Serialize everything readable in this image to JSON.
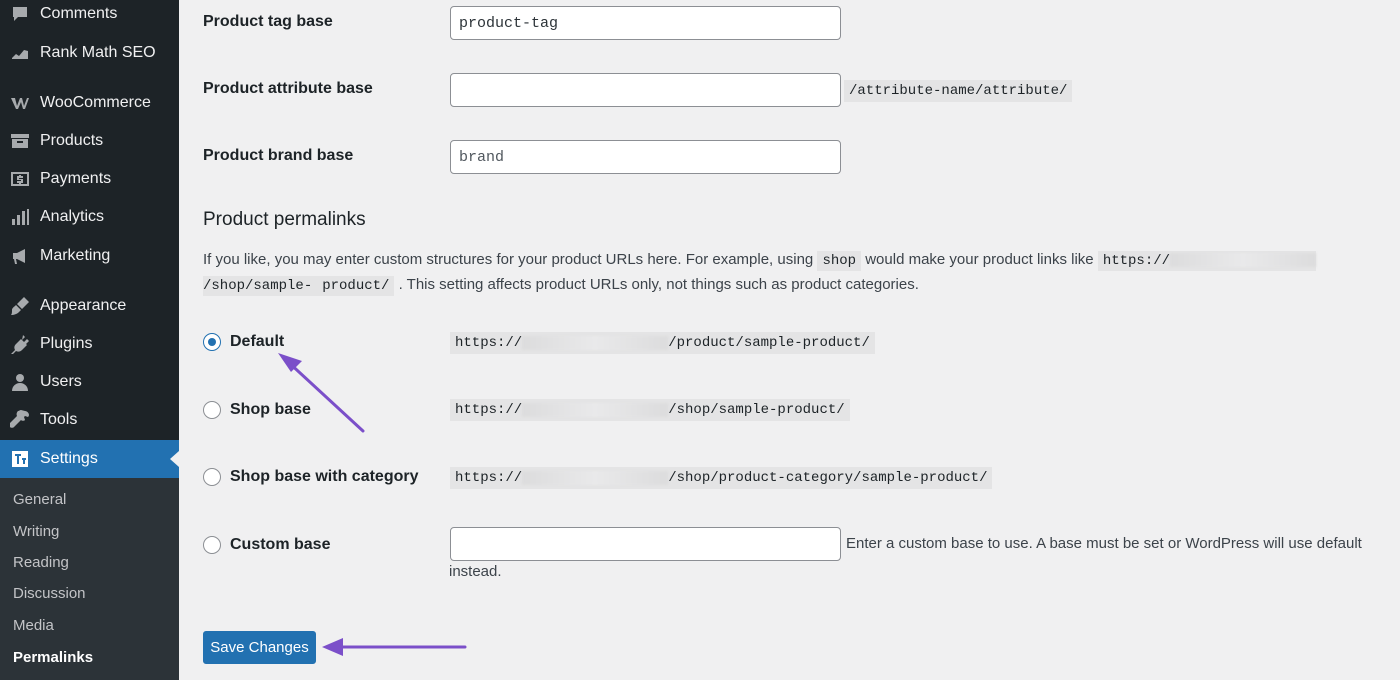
{
  "sidebar": {
    "items": [
      {
        "label": "Comments",
        "icon": "comment-icon"
      },
      {
        "label": "Rank Math SEO",
        "icon": "rank-math-icon"
      },
      {
        "label": "WooCommerce",
        "icon": "woocommerce-icon"
      },
      {
        "label": "Products",
        "icon": "archive-icon"
      },
      {
        "label": "Payments",
        "icon": "dollar-icon"
      },
      {
        "label": "Analytics",
        "icon": "bar-chart-icon"
      },
      {
        "label": "Marketing",
        "icon": "megaphone-icon"
      },
      {
        "label": "Appearance",
        "icon": "paintbrush-icon"
      },
      {
        "label": "Plugins",
        "icon": "plug-icon"
      },
      {
        "label": "Users",
        "icon": "user-icon"
      },
      {
        "label": "Tools",
        "icon": "wrench-icon"
      },
      {
        "label": "Settings",
        "icon": "settings-icon",
        "active": true
      }
    ],
    "submenu": [
      "General",
      "Writing",
      "Reading",
      "Discussion",
      "Media",
      "Permalinks"
    ],
    "submenu_current": "Permalinks"
  },
  "fields": {
    "tag_base": {
      "label": "Product tag base",
      "value": "product-tag"
    },
    "attribute_base": {
      "label": "Product attribute base",
      "value": "",
      "suffix": "/attribute-name/attribute/"
    },
    "brand_base": {
      "label": "Product brand base",
      "placeholder": "brand"
    }
  },
  "permalinks": {
    "title": "Product permalinks",
    "desc_1": "If you like, you may enter custom structures for your product URLs here. For example, using",
    "desc_code_shop": "shop",
    "desc_2": "would make your product links like",
    "desc_code_url_a": "https://",
    "desc_code_url_b": "/shop/sample-",
    "desc_code_url_c": "product/",
    "desc_3": ". This setting affects product URLs only, not things such as product categories.",
    "options": [
      {
        "label": "Default",
        "url_prefix": "https://",
        "url_suffix": "/product/sample-product/",
        "checked": true
      },
      {
        "label": "Shop base",
        "url_prefix": "https://",
        "url_suffix": "/shop/sample-product/",
        "checked": false
      },
      {
        "label": "Shop base with category",
        "url_prefix": "https://",
        "url_suffix": "/shop/product-category/sample-product/",
        "checked": false
      },
      {
        "label": "Custom base",
        "checked": false
      }
    ],
    "custom_help_1": "Enter a custom base to use. A base must be set or WordPress will use default",
    "custom_help_2": "instead."
  },
  "save_label": "Save Changes",
  "colors": {
    "accent": "#2271b1",
    "sidebar": "#1d2327",
    "annotation_arrow": "#7b4fc9"
  }
}
